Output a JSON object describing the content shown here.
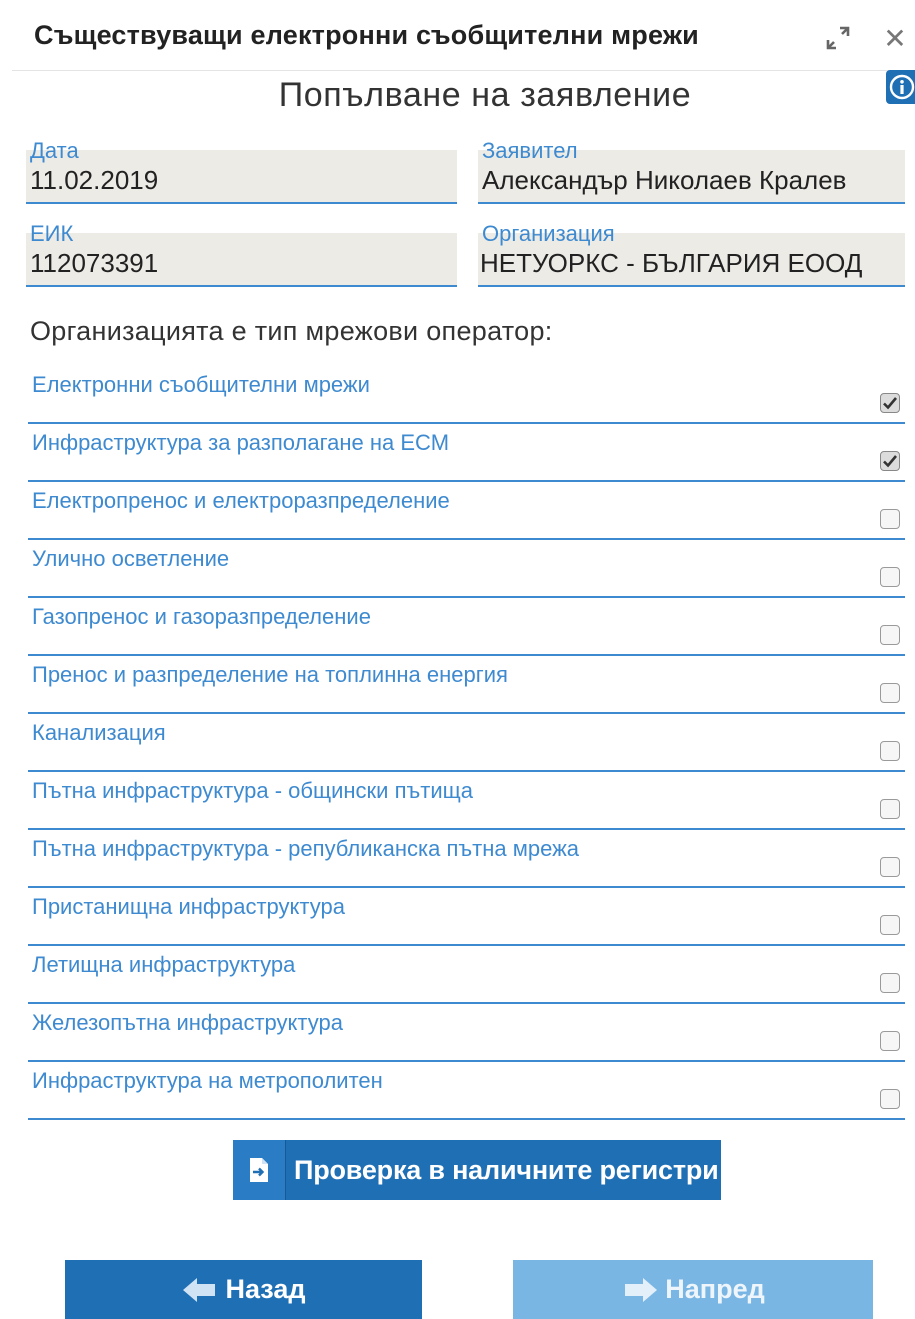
{
  "window": {
    "title": "Съществуващи електронни съобщителни мрежи",
    "maximize_icon": "expand-arrows-icon",
    "close_icon": "close-icon",
    "close_glyph": "✕"
  },
  "info_icon": "info-icon",
  "form": {
    "title": "Попълване на заявление",
    "fields": {
      "date": {
        "label": "Дата",
        "value": "11.02.2019"
      },
      "applicant": {
        "label": "Заявител",
        "value": "Александър Николаев Кралев"
      },
      "eik": {
        "label": "ЕИК",
        "value": "112073391"
      },
      "organization": {
        "label": "Организация",
        "value": "НЕТУОРКС - БЪЛГАРИЯ ЕООД"
      }
    },
    "operator_type_label": "Организацията е тип мрежови оператор:",
    "operator_types": [
      {
        "label": "Електронни съобщителни мрежи",
        "checked": true
      },
      {
        "label": "Инфраструктура за разполагане на ЕСМ",
        "checked": true
      },
      {
        "label": "Електропренос и електроразпределение",
        "checked": false
      },
      {
        "label": "Улично осветление",
        "checked": false
      },
      {
        "label": "Газопренос и газоразпределение",
        "checked": false
      },
      {
        "label": "Пренос и разпределение на топлинна енергия",
        "checked": false
      },
      {
        "label": "Канализация",
        "checked": false
      },
      {
        "label": "Пътна инфраструктура - общински пътища",
        "checked": false
      },
      {
        "label": "Пътна инфраструктура - републиканска пътна мрежа",
        "checked": false
      },
      {
        "label": "Пристанищна инфраструктура",
        "checked": false
      },
      {
        "label": "Летищна инфраструктура",
        "checked": false
      },
      {
        "label": "Железопътна инфраструктура",
        "checked": false
      },
      {
        "label": "Инфраструктура на метрополитен",
        "checked": false
      }
    ]
  },
  "actions": {
    "check_registers": {
      "label": "Проверка в наличните регистри",
      "icon": "document-arrow-icon"
    },
    "back": {
      "label": "Назад",
      "icon": "arrow-left-icon"
    },
    "next": {
      "label": "Напред",
      "icon": "arrow-right-icon",
      "enabled": false
    }
  },
  "colors": {
    "accent": "#1f6fb5",
    "label_blue": "#3e8ad0",
    "field_bg": "#edebe6",
    "disabled_button": "#7ab6e3"
  }
}
